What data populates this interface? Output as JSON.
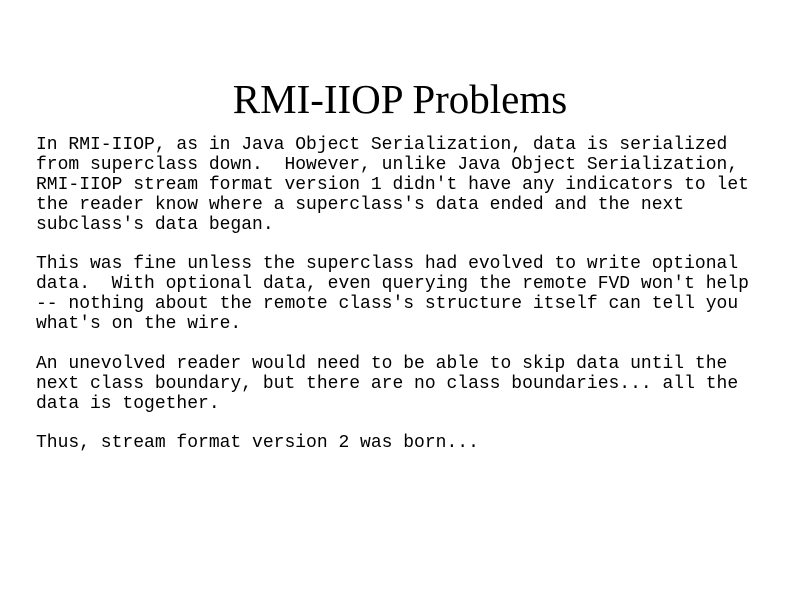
{
  "slide": {
    "title": "RMI-IIOP Problems",
    "paragraphs": [
      {
        "lines": [
          "In RMI-IIOP, as in Java Object Serialization, data is serialized",
          "from superclass down.  However, unlike Java Object Serialization,",
          "RMI-IIOP stream format version 1 didn't have any indicators to let",
          "the reader know where a superclass's data ended and the next",
          "subclass's data began."
        ]
      },
      {
        "lines": [
          "This was fine unless the superclass had evolved to write optional",
          "data.  With optional data, even querying the remote FVD won't help",
          "-- nothing about the remote class's structure itself can tell you",
          "what's on the wire."
        ]
      },
      {
        "lines": [
          "An unevolved reader would need to be able to skip data until the",
          "next class boundary, but there are no class boundaries... all the",
          "data is together."
        ]
      },
      {
        "lines": [
          "Thus, stream format version 2 was born..."
        ]
      }
    ]
  }
}
